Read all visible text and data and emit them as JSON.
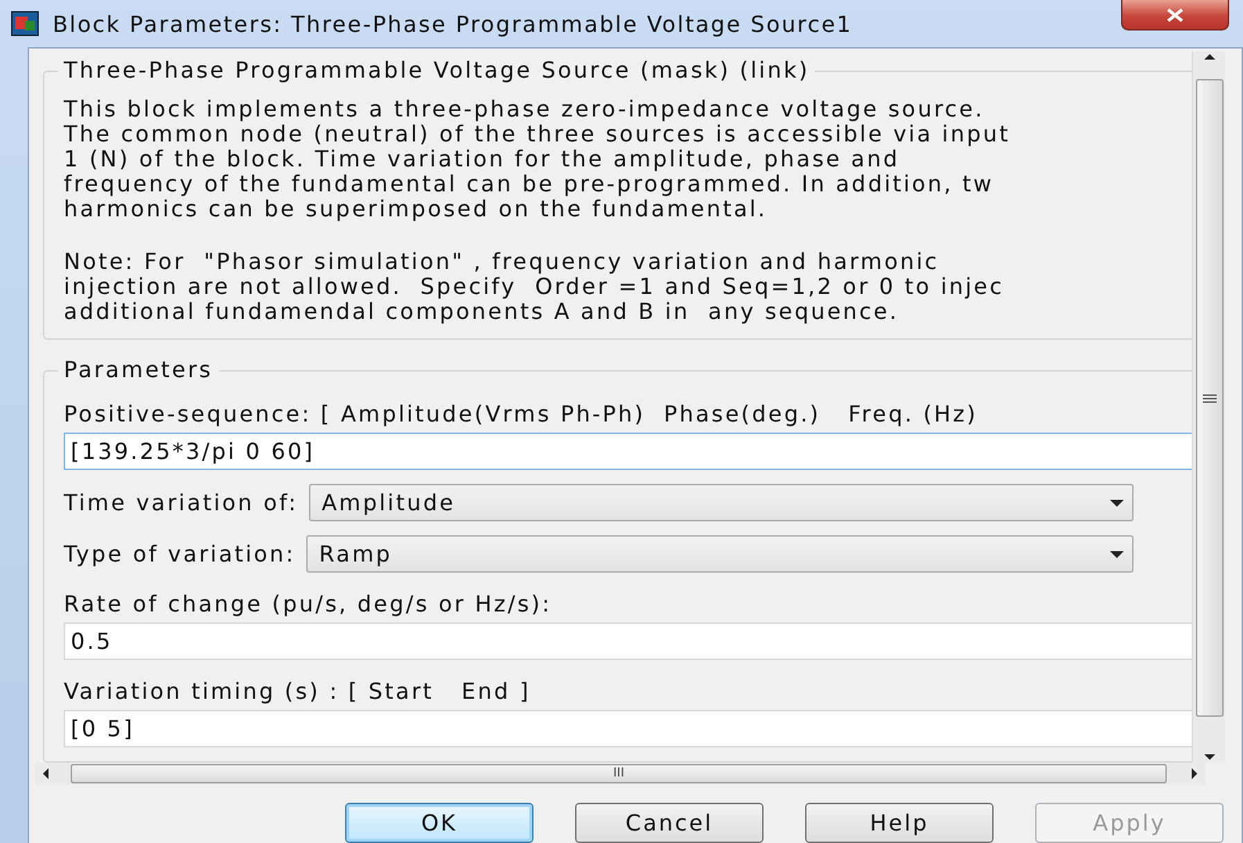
{
  "window": {
    "title": "Block Parameters: Three-Phase Programmable Voltage Source1"
  },
  "description": {
    "title": "Three-Phase Programmable Voltage Source (mask) (link)",
    "paragraphs": [
      [
        "This block implements a three-phase zero-impedance voltage source.",
        "The common node (neutral) of the three sources is accessible via input",
        "1 (N) of the block. Time variation for the amplitude, phase and",
        "frequency of the fundamental can be pre-programmed. In addition, tw",
        "harmonics can be superimposed on the fundamental."
      ],
      [
        "Note: For  \"Phasor simulation\" , frequency variation and harmonic",
        "injection are not allowed.  Specify  Order =1 and Seq=1,2 or 0 to injec",
        "additional fundamendal components A and B in  any sequence."
      ]
    ]
  },
  "parameters": {
    "title": "Parameters",
    "fields": [
      {
        "kind": "text",
        "label": "Positive-sequence: [ Amplitude(Vrms Ph-Ph)  Phase(deg.)   Freq. (Hz)",
        "value": "[139.25*3/pi 0 60]",
        "focused": true
      },
      {
        "kind": "select",
        "label": "Time variation of:",
        "value": "Amplitude"
      },
      {
        "kind": "select",
        "label": "Type of variation:",
        "value": "Ramp"
      },
      {
        "kind": "text",
        "label": "Rate of change (pu/s, deg/s or Hz/s):",
        "value": "0.5",
        "focused": false
      },
      {
        "kind": "text",
        "label": "Variation timing (s) : [ Start   End ]",
        "value": "[0 5]",
        "focused": false
      }
    ]
  },
  "hscroll_grip": "III",
  "buttons": [
    {
      "label": "OK",
      "default": true,
      "disabled": false
    },
    {
      "label": "Cancel",
      "default": false,
      "disabled": false
    },
    {
      "label": "Help",
      "default": false,
      "disabled": false
    },
    {
      "label": "Apply",
      "default": false,
      "disabled": true
    }
  ]
}
